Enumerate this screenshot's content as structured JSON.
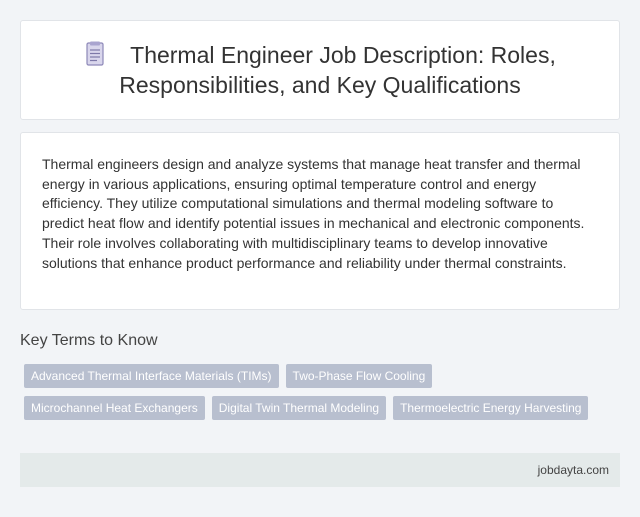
{
  "header": {
    "icon": "document-icon",
    "title": "Thermal Engineer Job Description: Roles, Responsibilities, and Key Qualifications"
  },
  "description": {
    "text": "Thermal engineers design and analyze systems that manage heat transfer and thermal energy in various applications, ensuring optimal temperature control and energy efficiency. They utilize computational simulations and thermal modeling software to predict heat flow and identify potential issues in mechanical and electronic components. Their role involves collaborating with multidisciplinary teams to develop innovative solutions that enhance product performance and reliability under thermal constraints."
  },
  "key_terms": {
    "heading": "Key Terms to Know",
    "rows": [
      [
        "Advanced Thermal Interface Materials (TIMs)",
        "Two-Phase Flow Cooling"
      ],
      [
        "Microchannel Heat Exchangers",
        "Digital Twin Thermal Modeling",
        "Thermoelectric Energy Harvesting"
      ]
    ]
  },
  "footer": {
    "site": "jobdayta.com"
  },
  "colors": {
    "tag_bg": "#b8bfcf",
    "footer_bg": "#e4eaea",
    "page_bg": "#f2f4f7"
  }
}
